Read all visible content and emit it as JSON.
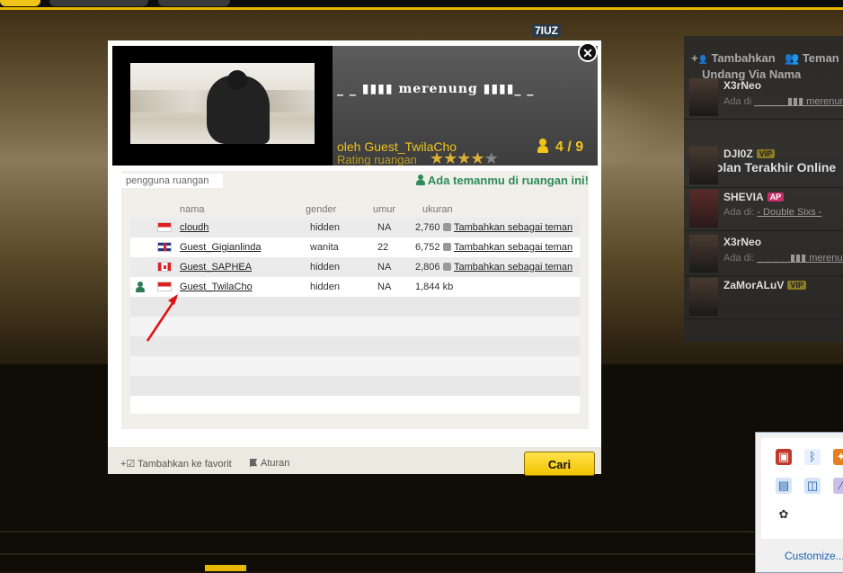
{
  "top_tabs": [
    "",
    "",
    ""
  ],
  "char_label": "7IUZ",
  "right_panel": {
    "add_label": "Tambahkan",
    "friend_label": "Teman",
    "invite_label": "Undang Via Nama",
    "top_contact": {
      "name": "X3rNeo",
      "sub": "Ada di",
      "room": "_ _ _ _ ▮▮▮ merenung"
    },
    "recent_title": "Obrolan Terakhir Online",
    "contacts": [
      {
        "name": "DJI0Z",
        "badge": "VIP",
        "sub": "",
        "room": ""
      },
      {
        "name": "SHEVIA",
        "badge": "AP",
        "sub": "Ada di:",
        "room": "- Double Sixs -"
      },
      {
        "name": "X3rNeo",
        "badge": "",
        "sub": "Ada di:",
        "room": "_ _ _ _ ▮▮▮ merenung"
      },
      {
        "name": "ZaMorALuV",
        "badge": "VIP",
        "sub": "",
        "room": ""
      }
    ]
  },
  "tray": {
    "customize_label": "Customize..."
  },
  "modal": {
    "room_name": "_ _ ▮▮▮▮ merenung ▮▮▮▮_ _",
    "owner": "oleh Guest_TwilaCho",
    "rating_label": "Rating ruangan",
    "rating_value": 3.5,
    "rating_max": 5,
    "occupancy": "4 / 9",
    "users_tab": "pengguna ruangan",
    "friend_notice": "Ada temanmu di ruangan ini!",
    "columns": {
      "name": "nama",
      "gender": "gender",
      "age": "umur",
      "size": "ukuran"
    },
    "users": [
      {
        "name": "cloudh",
        "flag": "id",
        "gender": "hidden",
        "age": "NA",
        "size": "2,760",
        "action": "Tambahkan sebagai teman",
        "is_friend": false
      },
      {
        "name": "Guest_Gigianlinda",
        "flag": "uk",
        "gender": "wanita",
        "age": "22",
        "size": "6,752",
        "action": "Tambahkan sebagai teman",
        "is_friend": false
      },
      {
        "name": "Guest_SAPHEA",
        "flag": "ca",
        "gender": "hidden",
        "age": "NA",
        "size": "2,806",
        "action": "Tambahkan sebagai teman",
        "is_friend": false
      },
      {
        "name": "Guest_TwilaCho",
        "flag": "id",
        "gender": "hidden",
        "age": "NA",
        "size": "1,844 kb",
        "action": "",
        "is_friend": true
      }
    ],
    "footer": {
      "favorite_label": "Tambahkan ke favorit",
      "rules_label": "Aturan",
      "search_label": "Cari"
    }
  },
  "colors": {
    "accent": "#f0c419",
    "friend_green": "#2e8b57",
    "button_yellow": "#f3c300"
  }
}
